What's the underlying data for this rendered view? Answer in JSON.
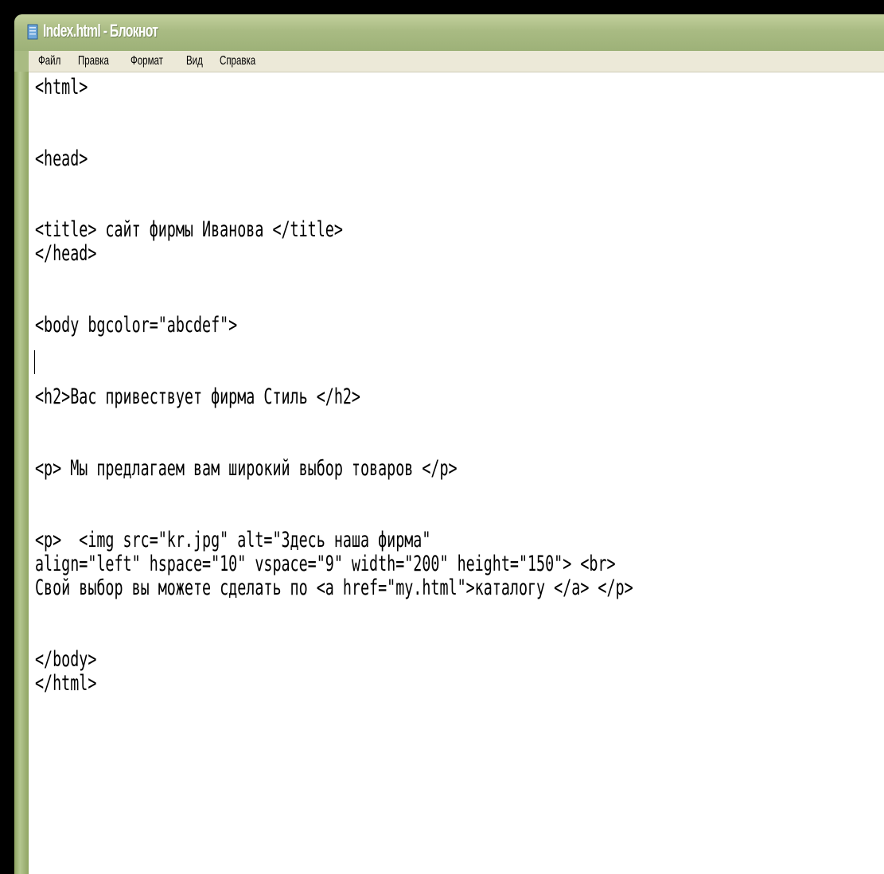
{
  "window": {
    "title": "Index.html - Блокнот",
    "icon": "notepad-icon"
  },
  "menu": {
    "items": [
      "Файл",
      "Правка",
      "Формат",
      "Вид",
      "Справка"
    ]
  },
  "editor": {
    "lines": [
      "<html>",
      "",
      "<head>",
      "",
      "<title> сайт фирмы Иванова </title>",
      "</head>",
      "",
      "<body bgcolor=\"abcdef\">",
      "",
      "<h2>Вас привествует фирма Стиль </h2>",
      "",
      "<p> Мы предлагаем вам широкий выбор товаров </p>",
      "",
      "<p>  <img src=\"kr.jpg\" alt=\"Здесь наша фирма\"",
      "align=\"left\" hspace=\"10\" vspace=\"9\" width=\"200\" height=\"150\"> <br>",
      "Свой выбор вы можете сделать по <a href=\"my.html\">каталогу </a> </p>",
      "",
      "",
      "</body>",
      "</html>"
    ]
  }
}
